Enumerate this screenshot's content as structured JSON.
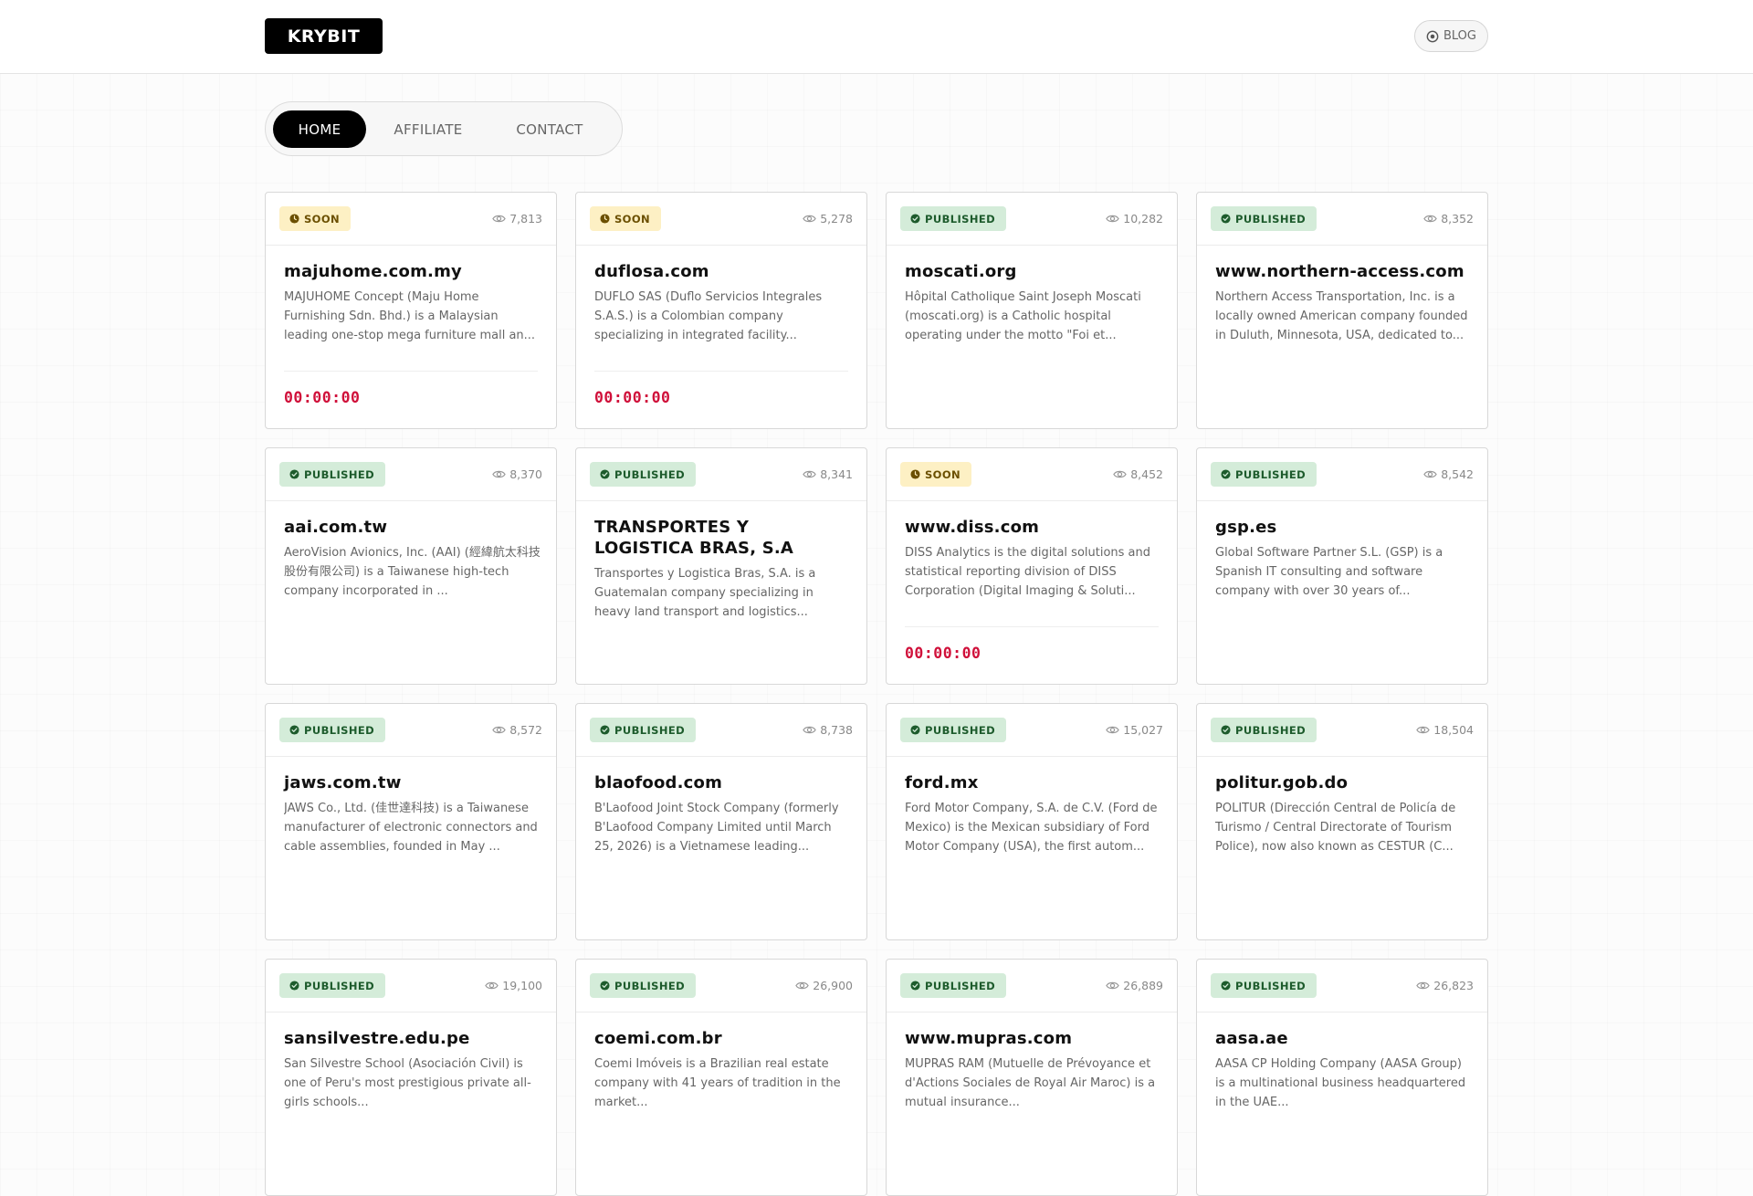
{
  "header": {
    "logo": "KRYBIT",
    "blog_label": "BLOG"
  },
  "tabs": [
    {
      "label": "HOME",
      "active": true
    },
    {
      "label": "AFFILIATE",
      "active": false
    },
    {
      "label": "CONTACT",
      "active": false
    }
  ],
  "colors": {
    "soon_badge_bg": "#fdf0c4",
    "published_badge_bg": "#d4ecd9",
    "countdown": "#d0103a"
  },
  "cards": [
    {
      "status": "SOON",
      "views": "7,813",
      "title": "majuhome.com.my",
      "desc": "MAJUHOME Concept (Maju Home Furnishing Sdn. Bhd.) is a Malaysian leading one-stop mega furniture mall an...",
      "countdown": "00:00:00"
    },
    {
      "status": "SOON",
      "views": "5,278",
      "title": "duflosa.com",
      "desc": "DUFLO SAS (Duflo Servicios Integrales S.A.S.) is a Colombian company specializing in integrated facility...",
      "countdown": "00:00:00"
    },
    {
      "status": "PUBLISHED",
      "views": "10,282",
      "title": "moscati.org",
      "desc": "Hôpital Catholique Saint Joseph Moscati (moscati.org) is a Catholic hospital operating under the motto \"Foi et...",
      "countdown": ""
    },
    {
      "status": "PUBLISHED",
      "views": "8,352",
      "title": "www.northern-access.com",
      "desc": "Northern Access Transportation, Inc. is a locally owned American company founded in Duluth, Minnesota, USA, dedicated to...",
      "countdown": ""
    },
    {
      "status": "PUBLISHED",
      "views": "8,370",
      "title": "aai.com.tw",
      "desc": "AeroVision Avionics, Inc. (AAI) (經緯航太科技股份有限公司) is a Taiwanese high-tech company incorporated in ...",
      "countdown": ""
    },
    {
      "status": "PUBLISHED",
      "views": "8,341",
      "title": "TRANSPORTES Y LOGISTICA BRAS, S.A",
      "desc": "Transportes y Logistica Bras, S.A. is a Guatemalan company specializing in heavy land transport and logistics...",
      "countdown": ""
    },
    {
      "status": "SOON",
      "views": "8,452",
      "title": "www.diss.com",
      "desc": "DISS Analytics is the digital solutions and statistical reporting division of DISS Corporation (Digital Imaging & Soluti...",
      "countdown": "00:00:00"
    },
    {
      "status": "PUBLISHED",
      "views": "8,542",
      "title": "gsp.es",
      "desc": "Global Software Partner S.L. (GSP) is a Spanish IT consulting and software company with over 30 years of...",
      "countdown": ""
    },
    {
      "status": "PUBLISHED",
      "views": "8,572",
      "title": "jaws.com.tw",
      "desc": "JAWS Co., Ltd. (佳世達科技) is a Taiwanese manufacturer of electronic connectors and cable assemblies, founded in May ...",
      "countdown": ""
    },
    {
      "status": "PUBLISHED",
      "views": "8,738",
      "title": "blaofood.com",
      "desc": "B'Laofood Joint Stock Company (formerly B'Laofood Company Limited until March 25, 2026) is a Vietnamese leading...",
      "countdown": ""
    },
    {
      "status": "PUBLISHED",
      "views": "15,027",
      "title": "ford.mx",
      "desc": "Ford Motor Company, S.A. de C.V. (Ford de Mexico) is the Mexican subsidiary of Ford Motor Company (USA), the first autom...",
      "countdown": ""
    },
    {
      "status": "PUBLISHED",
      "views": "18,504",
      "title": "politur.gob.do",
      "desc": "POLITUR (Dirección Central de Policía de Turismo / Central Directorate of Tourism Police), now also known as CESTUR (C...",
      "countdown": ""
    },
    {
      "status": "PUBLISHED",
      "views": "19,100",
      "title": "sansilvestre.edu.pe",
      "desc": "San Silvestre School (Asociación Civil) is one of Peru's most prestigious private all-girls schools...",
      "countdown": ""
    },
    {
      "status": "PUBLISHED",
      "views": "26,900",
      "title": "coemi.com.br",
      "desc": "Coemi Imóveis is a Brazilian real estate company with 41 years of tradition in the market...",
      "countdown": ""
    },
    {
      "status": "PUBLISHED",
      "views": "26,889",
      "title": "www.mupras.com",
      "desc": "MUPRAS RAM (Mutuelle de Prévoyance et d'Actions Sociales de Royal Air Maroc) is a mutual insurance...",
      "countdown": ""
    },
    {
      "status": "PUBLISHED",
      "views": "26,823",
      "title": "aasa.ae",
      "desc": "AASA CP Holding Company (AASA Group) is a multinational business headquartered in the UAE...",
      "countdown": ""
    }
  ]
}
